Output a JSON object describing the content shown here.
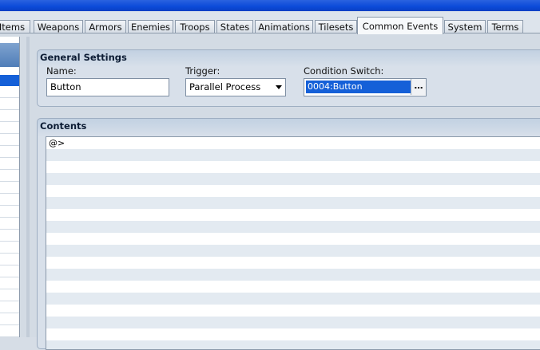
{
  "tabs": [
    {
      "label": "Items",
      "active": false
    },
    {
      "label": "Weapons",
      "active": false
    },
    {
      "label": "Armors",
      "active": false
    },
    {
      "label": "Enemies",
      "active": false
    },
    {
      "label": "Troops",
      "active": false
    },
    {
      "label": "States",
      "active": false
    },
    {
      "label": "Animations",
      "active": false
    },
    {
      "label": "Tilesets",
      "active": false
    },
    {
      "label": "Common Events",
      "active": true
    },
    {
      "label": "System",
      "active": false
    },
    {
      "label": "Terms",
      "active": false
    }
  ],
  "general_settings": {
    "title": "General Settings",
    "name_label": "Name:",
    "name_value": "Button",
    "trigger_label": "Trigger:",
    "trigger_value": "Parallel Process",
    "condition_label": "Condition Switch:",
    "condition_value": "0004:Button",
    "browse_label": "…"
  },
  "contents": {
    "title": "Contents",
    "lines": [
      "@>"
    ]
  },
  "colors": {
    "accent": "#1560d8",
    "title_bar": "#0b4ad8"
  }
}
